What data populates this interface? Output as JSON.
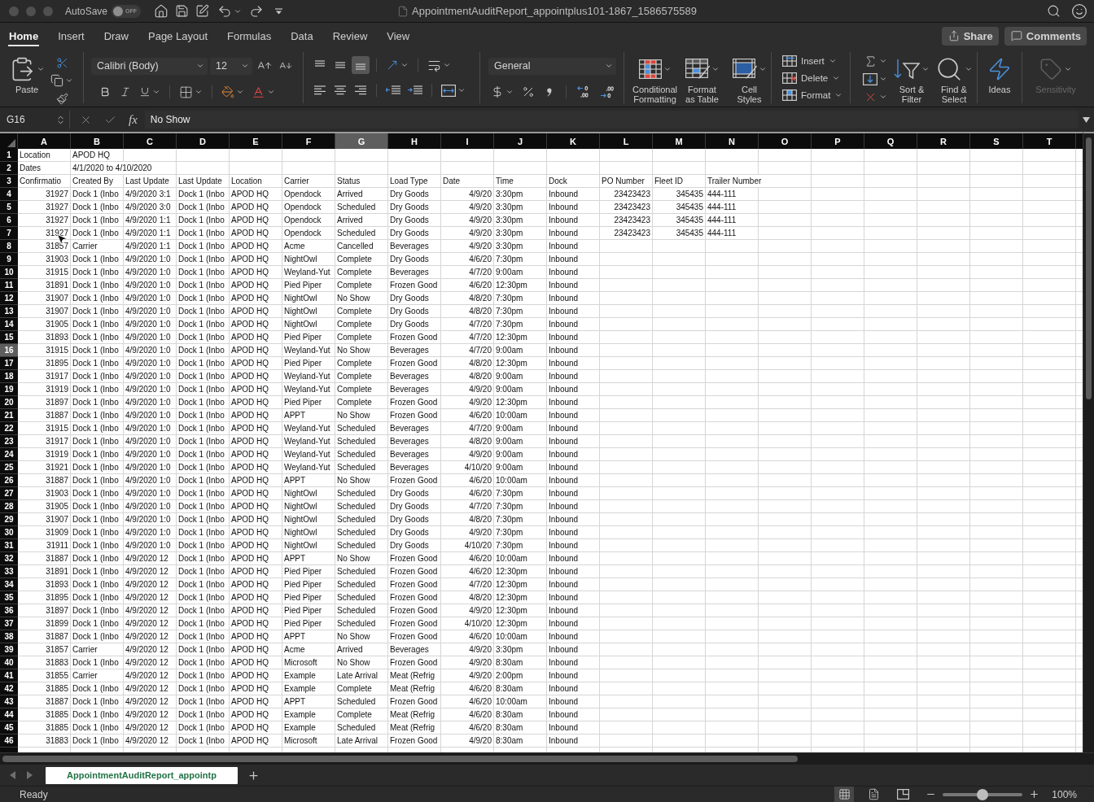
{
  "window": {
    "title": "AppointmentAuditReport_appointplus101-1867_1586575589",
    "autosave": {
      "label": "AutoSave",
      "on": false,
      "text": "OFF"
    }
  },
  "ribbon_tabs": [
    {
      "label": "Home",
      "selected": true
    },
    {
      "label": "Insert",
      "selected": false
    },
    {
      "label": "Draw",
      "selected": false
    },
    {
      "label": "Page Layout",
      "selected": false
    },
    {
      "label": "Formulas",
      "selected": false
    },
    {
      "label": "Data",
      "selected": false
    },
    {
      "label": "Review",
      "selected": false
    },
    {
      "label": "View",
      "selected": false
    }
  ],
  "header_actions": [
    {
      "kind": "share",
      "label": "Share"
    },
    {
      "kind": "comments",
      "label": "Comments"
    }
  ],
  "ribbon": {
    "paste_label": "Paste",
    "font_name": "Calibri (Body)",
    "font_size": "12",
    "vertical_alignment": [
      {
        "kind": "top",
        "selected": false
      },
      {
        "kind": "middle",
        "selected": false
      },
      {
        "kind": "bottom",
        "selected": true
      }
    ],
    "horizontal_alignment": [
      {
        "kind": "left",
        "selected": false
      },
      {
        "kind": "center",
        "selected": false
      },
      {
        "kind": "right",
        "selected": false
      }
    ],
    "number_format": "General",
    "styles": [
      {
        "kind": "conditional",
        "label": "Conditional\nFormatting"
      },
      {
        "kind": "table",
        "label": "Format\nas Table"
      },
      {
        "kind": "cell_styles",
        "label": "Cell\nStyles"
      }
    ],
    "cells": [
      {
        "kind": "insert",
        "label": "Insert"
      },
      {
        "kind": "delete",
        "label": "Delete"
      },
      {
        "kind": "format",
        "label": "Format"
      }
    ],
    "editing": [
      {
        "kind": "sort",
        "label": "Sort &\nFilter"
      },
      {
        "kind": "find",
        "label": "Find &\nSelect"
      }
    ],
    "insights": [
      {
        "kind": "ideas",
        "label": "Ideas",
        "disabled": false
      },
      {
        "kind": "sensitivity",
        "label": "Sensitivity",
        "disabled": true
      }
    ]
  },
  "formula_bar": {
    "name_box": "G16",
    "function_symbol": "fx",
    "formula": "No Show"
  },
  "sheet": {
    "column_letters": [
      {
        "label": "A",
        "selected": false
      },
      {
        "label": "B",
        "selected": false
      },
      {
        "label": "C",
        "selected": false
      },
      {
        "label": "D",
        "selected": false
      },
      {
        "label": "E",
        "selected": false
      },
      {
        "label": "F",
        "selected": false
      },
      {
        "label": "G",
        "selected": true
      },
      {
        "label": "H",
        "selected": false
      },
      {
        "label": "I",
        "selected": false
      },
      {
        "label": "J",
        "selected": false
      },
      {
        "label": "K",
        "selected": false
      },
      {
        "label": "L",
        "selected": false
      },
      {
        "label": "M",
        "selected": false
      },
      {
        "label": "N",
        "selected": false
      },
      {
        "label": "O",
        "selected": false
      },
      {
        "label": "P",
        "selected": false
      },
      {
        "label": "Q",
        "selected": false
      },
      {
        "label": "R",
        "selected": false
      },
      {
        "label": "S",
        "selected": false
      },
      {
        "label": "T",
        "selected": false
      }
    ],
    "fields": [
      {
        "heading": "Confirmatio",
        "numeric": true
      },
      {
        "heading": "Created By",
        "numeric": false
      },
      {
        "heading": "Last Update",
        "numeric": false
      },
      {
        "heading": "Last Update",
        "numeric": false
      },
      {
        "heading": "Location",
        "numeric": false
      },
      {
        "heading": "Carrier",
        "numeric": false
      },
      {
        "heading": "Status",
        "numeric": false
      },
      {
        "heading": "Load Type",
        "numeric": false
      },
      {
        "heading": "Date",
        "numeric": true
      },
      {
        "heading": "Time",
        "numeric": false
      },
      {
        "heading": "Dock",
        "numeric": false
      },
      {
        "heading": "PO Number",
        "numeric": true
      },
      {
        "heading": "Fleet ID",
        "numeric": true
      },
      {
        "heading": "Trailer Number",
        "numeric": false
      }
    ],
    "rows": [
      {
        "number": "1",
        "selected": false,
        "kind": "info",
        "cells": [
          "Location",
          "APOD HQ"
        ]
      },
      {
        "number": "2",
        "selected": false,
        "kind": "info",
        "cells": [
          "Dates",
          "4/1/2020 to 4/10/2020"
        ]
      },
      {
        "number": "3",
        "selected": false,
        "kind": "header"
      },
      {
        "number": "4",
        "selected": false,
        "kind": "record",
        "cells": [
          "31927",
          "Dock 1 (Inbo",
          "4/9/2020 3:1",
          "Dock 1 (Inbo",
          "APOD HQ",
          "Opendock",
          "Arrived",
          "Dry Goods",
          "4/9/20",
          "3:30pm",
          "Inbound",
          "23423423",
          "345435",
          "444-111"
        ]
      },
      {
        "number": "5",
        "selected": false,
        "kind": "record",
        "cells": [
          "31927",
          "Dock 1 (Inbo",
          "4/9/2020 3:0",
          "Dock 1 (Inbo",
          "APOD HQ",
          "Opendock",
          "Scheduled",
          "Dry Goods",
          "4/9/20",
          "3:30pm",
          "Inbound",
          "23423423",
          "345435",
          "444-111"
        ]
      },
      {
        "number": "6",
        "selected": false,
        "kind": "record",
        "cells": [
          "31927",
          "Dock 1 (Inbo",
          "4/9/2020 1:1",
          "Dock 1 (Inbo",
          "APOD HQ",
          "Opendock",
          "Arrived",
          "Dry Goods",
          "4/9/20",
          "3:30pm",
          "Inbound",
          "23423423",
          "345435",
          "444-111"
        ]
      },
      {
        "number": "7",
        "selected": false,
        "kind": "record",
        "cells": [
          "31927",
          "Dock 1 (Inbo",
          "4/9/2020 1:1",
          "Dock 1 (Inbo",
          "APOD HQ",
          "Opendock",
          "Scheduled",
          "Dry Goods",
          "4/9/20",
          "3:30pm",
          "Inbound",
          "23423423",
          "345435",
          "444-111"
        ]
      },
      {
        "number": "8",
        "selected": false,
        "kind": "record",
        "cells": [
          "31857",
          "Carrier",
          "4/9/2020 1:1",
          "Dock 1 (Inbo",
          "APOD HQ",
          "Acme",
          "Cancelled",
          "Beverages",
          "4/9/20",
          "3:30pm",
          "Inbound"
        ]
      },
      {
        "number": "9",
        "selected": false,
        "kind": "record",
        "cells": [
          "31903",
          "Dock 1 (Inbo",
          "4/9/2020 1:0",
          "Dock 1 (Inbo",
          "APOD HQ",
          "NightOwl",
          "Complete",
          "Dry Goods",
          "4/6/20",
          "7:30pm",
          "Inbound"
        ]
      },
      {
        "number": "10",
        "selected": false,
        "kind": "record",
        "cells": [
          "31915",
          "Dock 1 (Inbo",
          "4/9/2020 1:0",
          "Dock 1 (Inbo",
          "APOD HQ",
          "Weyland-Yut",
          "Complete",
          "Beverages",
          "4/7/20",
          "9:00am",
          "Inbound"
        ]
      },
      {
        "number": "11",
        "selected": false,
        "kind": "record",
        "cells": [
          "31891",
          "Dock 1 (Inbo",
          "4/9/2020 1:0",
          "Dock 1 (Inbo",
          "APOD HQ",
          "Pied Piper",
          "Complete",
          "Frozen Good",
          "4/6/20",
          "12:30pm",
          "Inbound"
        ]
      },
      {
        "number": "12",
        "selected": false,
        "kind": "record",
        "cells": [
          "31907",
          "Dock 1 (Inbo",
          "4/9/2020 1:0",
          "Dock 1 (Inbo",
          "APOD HQ",
          "NightOwl",
          "No Show",
          "Dry Goods",
          "4/8/20",
          "7:30pm",
          "Inbound"
        ]
      },
      {
        "number": "13",
        "selected": false,
        "kind": "record",
        "cells": [
          "31907",
          "Dock 1 (Inbo",
          "4/9/2020 1:0",
          "Dock 1 (Inbo",
          "APOD HQ",
          "NightOwl",
          "Complete",
          "Dry Goods",
          "4/8/20",
          "7:30pm",
          "Inbound"
        ]
      },
      {
        "number": "14",
        "selected": false,
        "kind": "record",
        "cells": [
          "31905",
          "Dock 1 (Inbo",
          "4/9/2020 1:0",
          "Dock 1 (Inbo",
          "APOD HQ",
          "NightOwl",
          "Complete",
          "Dry Goods",
          "4/7/20",
          "7:30pm",
          "Inbound"
        ]
      },
      {
        "number": "15",
        "selected": false,
        "kind": "record",
        "cells": [
          "31893",
          "Dock 1 (Inbo",
          "4/9/2020 1:0",
          "Dock 1 (Inbo",
          "APOD HQ",
          "Pied Piper",
          "Complete",
          "Frozen Good",
          "4/7/20",
          "12:30pm",
          "Inbound"
        ]
      },
      {
        "number": "16",
        "selected": true,
        "kind": "record",
        "cells": [
          "31915",
          "Dock 1 (Inbo",
          "4/9/2020 1:0",
          "Dock 1 (Inbo",
          "APOD HQ",
          "Weyland-Yut",
          "No Show",
          "Beverages",
          "4/7/20",
          "9:00am",
          "Inbound"
        ]
      },
      {
        "number": "17",
        "selected": false,
        "kind": "record",
        "cells": [
          "31895",
          "Dock 1 (Inbo",
          "4/9/2020 1:0",
          "Dock 1 (Inbo",
          "APOD HQ",
          "Pied Piper",
          "Complete",
          "Frozen Good",
          "4/8/20",
          "12:30pm",
          "Inbound"
        ]
      },
      {
        "number": "18",
        "selected": false,
        "kind": "record",
        "cells": [
          "31917",
          "Dock 1 (Inbo",
          "4/9/2020 1:0",
          "Dock 1 (Inbo",
          "APOD HQ",
          "Weyland-Yut",
          "Complete",
          "Beverages",
          "4/8/20",
          "9:00am",
          "Inbound"
        ]
      },
      {
        "number": "19",
        "selected": false,
        "kind": "record",
        "cells": [
          "31919",
          "Dock 1 (Inbo",
          "4/9/2020 1:0",
          "Dock 1 (Inbo",
          "APOD HQ",
          "Weyland-Yut",
          "Complete",
          "Beverages",
          "4/9/20",
          "9:00am",
          "Inbound"
        ]
      },
      {
        "number": "20",
        "selected": false,
        "kind": "record",
        "cells": [
          "31897",
          "Dock 1 (Inbo",
          "4/9/2020 1:0",
          "Dock 1 (Inbo",
          "APOD HQ",
          "Pied Piper",
          "Complete",
          "Frozen Good",
          "4/9/20",
          "12:30pm",
          "Inbound"
        ]
      },
      {
        "number": "21",
        "selected": false,
        "kind": "record",
        "cells": [
          "31887",
          "Dock 1 (Inbo",
          "4/9/2020 1:0",
          "Dock 1 (Inbo",
          "APOD HQ",
          "APPT",
          "No Show",
          "Frozen Good",
          "4/6/20",
          "10:00am",
          "Inbound"
        ]
      },
      {
        "number": "22",
        "selected": false,
        "kind": "record",
        "cells": [
          "31915",
          "Dock 1 (Inbo",
          "4/9/2020 1:0",
          "Dock 1 (Inbo",
          "APOD HQ",
          "Weyland-Yut",
          "Scheduled",
          "Beverages",
          "4/7/20",
          "9:00am",
          "Inbound"
        ]
      },
      {
        "number": "23",
        "selected": false,
        "kind": "record",
        "cells": [
          "31917",
          "Dock 1 (Inbo",
          "4/9/2020 1:0",
          "Dock 1 (Inbo",
          "APOD HQ",
          "Weyland-Yut",
          "Scheduled",
          "Beverages",
          "4/8/20",
          "9:00am",
          "Inbound"
        ]
      },
      {
        "number": "24",
        "selected": false,
        "kind": "record",
        "cells": [
          "31919",
          "Dock 1 (Inbo",
          "4/9/2020 1:0",
          "Dock 1 (Inbo",
          "APOD HQ",
          "Weyland-Yut",
          "Scheduled",
          "Beverages",
          "4/9/20",
          "9:00am",
          "Inbound"
        ]
      },
      {
        "number": "25",
        "selected": false,
        "kind": "record",
        "cells": [
          "31921",
          "Dock 1 (Inbo",
          "4/9/2020 1:0",
          "Dock 1 (Inbo",
          "APOD HQ",
          "Weyland-Yut",
          "Scheduled",
          "Beverages",
          "4/10/20",
          "9:00am",
          "Inbound"
        ]
      },
      {
        "number": "26",
        "selected": false,
        "kind": "record",
        "cells": [
          "31887",
          "Dock 1 (Inbo",
          "4/9/2020 1:0",
          "Dock 1 (Inbo",
          "APOD HQ",
          "APPT",
          "No Show",
          "Frozen Good",
          "4/6/20",
          "10:00am",
          "Inbound"
        ]
      },
      {
        "number": "27",
        "selected": false,
        "kind": "record",
        "cells": [
          "31903",
          "Dock 1 (Inbo",
          "4/9/2020 1:0",
          "Dock 1 (Inbo",
          "APOD HQ",
          "NightOwl",
          "Scheduled",
          "Dry Goods",
          "4/6/20",
          "7:30pm",
          "Inbound"
        ]
      },
      {
        "number": "28",
        "selected": false,
        "kind": "record",
        "cells": [
          "31905",
          "Dock 1 (Inbo",
          "4/9/2020 1:0",
          "Dock 1 (Inbo",
          "APOD HQ",
          "NightOwl",
          "Scheduled",
          "Dry Goods",
          "4/7/20",
          "7:30pm",
          "Inbound"
        ]
      },
      {
        "number": "29",
        "selected": false,
        "kind": "record",
        "cells": [
          "31907",
          "Dock 1 (Inbo",
          "4/9/2020 1:0",
          "Dock 1 (Inbo",
          "APOD HQ",
          "NightOwl",
          "Scheduled",
          "Dry Goods",
          "4/8/20",
          "7:30pm",
          "Inbound"
        ]
      },
      {
        "number": "30",
        "selected": false,
        "kind": "record",
        "cells": [
          "31909",
          "Dock 1 (Inbo",
          "4/9/2020 1:0",
          "Dock 1 (Inbo",
          "APOD HQ",
          "NightOwl",
          "Scheduled",
          "Dry Goods",
          "4/9/20",
          "7:30pm",
          "Inbound"
        ]
      },
      {
        "number": "31",
        "selected": false,
        "kind": "record",
        "cells": [
          "31911",
          "Dock 1 (Inbo",
          "4/9/2020 1:0",
          "Dock 1 (Inbo",
          "APOD HQ",
          "NightOwl",
          "Scheduled",
          "Dry Goods",
          "4/10/20",
          "7:30pm",
          "Inbound"
        ]
      },
      {
        "number": "32",
        "selected": false,
        "kind": "record",
        "cells": [
          "31887",
          "Dock 1 (Inbo",
          "4/9/2020 12",
          "Dock 1 (Inbo",
          "APOD HQ",
          "APPT",
          "No Show",
          "Frozen Good",
          "4/6/20",
          "10:00am",
          "Inbound"
        ]
      },
      {
        "number": "33",
        "selected": false,
        "kind": "record",
        "cells": [
          "31891",
          "Dock 1 (Inbo",
          "4/9/2020 12",
          "Dock 1 (Inbo",
          "APOD HQ",
          "Pied Piper",
          "Scheduled",
          "Frozen Good",
          "4/6/20",
          "12:30pm",
          "Inbound"
        ]
      },
      {
        "number": "34",
        "selected": false,
        "kind": "record",
        "cells": [
          "31893",
          "Dock 1 (Inbo",
          "4/9/2020 12",
          "Dock 1 (Inbo",
          "APOD HQ",
          "Pied Piper",
          "Scheduled",
          "Frozen Good",
          "4/7/20",
          "12:30pm",
          "Inbound"
        ]
      },
      {
        "number": "35",
        "selected": false,
        "kind": "record",
        "cells": [
          "31895",
          "Dock 1 (Inbo",
          "4/9/2020 12",
          "Dock 1 (Inbo",
          "APOD HQ",
          "Pied Piper",
          "Scheduled",
          "Frozen Good",
          "4/8/20",
          "12:30pm",
          "Inbound"
        ]
      },
      {
        "number": "36",
        "selected": false,
        "kind": "record",
        "cells": [
          "31897",
          "Dock 1 (Inbo",
          "4/9/2020 12",
          "Dock 1 (Inbo",
          "APOD HQ",
          "Pied Piper",
          "Scheduled",
          "Frozen Good",
          "4/9/20",
          "12:30pm",
          "Inbound"
        ]
      },
      {
        "number": "37",
        "selected": false,
        "kind": "record",
        "cells": [
          "31899",
          "Dock 1 (Inbo",
          "4/9/2020 12",
          "Dock 1 (Inbo",
          "APOD HQ",
          "Pied Piper",
          "Scheduled",
          "Frozen Good",
          "4/10/20",
          "12:30pm",
          "Inbound"
        ]
      },
      {
        "number": "38",
        "selected": false,
        "kind": "record",
        "cells": [
          "31887",
          "Dock 1 (Inbo",
          "4/9/2020 12",
          "Dock 1 (Inbo",
          "APOD HQ",
          "APPT",
          "No Show",
          "Frozen Good",
          "4/6/20",
          "10:00am",
          "Inbound"
        ]
      },
      {
        "number": "39",
        "selected": false,
        "kind": "record",
        "cells": [
          "31857",
          "Carrier",
          "4/9/2020 12",
          "Dock 1 (Inbo",
          "APOD HQ",
          "Acme",
          "Arrived",
          "Beverages",
          "4/9/20",
          "3:30pm",
          "Inbound"
        ]
      },
      {
        "number": "40",
        "selected": false,
        "kind": "record",
        "cells": [
          "31883",
          "Dock 1 (Inbo",
          "4/9/2020 12",
          "Dock 1 (Inbo",
          "APOD HQ",
          "Microsoft",
          "No Show",
          "Frozen Good",
          "4/9/20",
          "8:30am",
          "Inbound"
        ]
      },
      {
        "number": "41",
        "selected": false,
        "kind": "record",
        "cells": [
          "31855",
          "Carrier",
          "4/9/2020 12",
          "Dock 1 (Inbo",
          "APOD HQ",
          "Example",
          "Late Arrival",
          "Meat (Refrig",
          "4/9/20",
          "2:00pm",
          "Inbound"
        ]
      },
      {
        "number": "42",
        "selected": false,
        "kind": "record",
        "cells": [
          "31885",
          "Dock 1 (Inbo",
          "4/9/2020 12",
          "Dock 1 (Inbo",
          "APOD HQ",
          "Example",
          "Complete",
          "Meat (Refrig",
          "4/6/20",
          "8:30am",
          "Inbound"
        ]
      },
      {
        "number": "43",
        "selected": false,
        "kind": "record",
        "cells": [
          "31887",
          "Dock 1 (Inbo",
          "4/9/2020 12",
          "Dock 1 (Inbo",
          "APOD HQ",
          "APPT",
          "Scheduled",
          "Frozen Good",
          "4/6/20",
          "10:00am",
          "Inbound"
        ]
      },
      {
        "number": "44",
        "selected": false,
        "kind": "record",
        "cells": [
          "31885",
          "Dock 1 (Inbo",
          "4/9/2020 12",
          "Dock 1 (Inbo",
          "APOD HQ",
          "Example",
          "Complete",
          "Meat (Refrig",
          "4/6/20",
          "8:30am",
          "Inbound"
        ]
      },
      {
        "number": "45",
        "selected": false,
        "kind": "record",
        "cells": [
          "31885",
          "Dock 1 (Inbo",
          "4/9/2020 12",
          "Dock 1 (Inbo",
          "APOD HQ",
          "Example",
          "Scheduled",
          "Meat (Refrig",
          "4/6/20",
          "8:30am",
          "Inbound"
        ]
      },
      {
        "number": "46",
        "selected": false,
        "kind": "record",
        "cells": [
          "31883",
          "Dock 1 (Inbo",
          "4/9/2020 12",
          "Dock 1 (Inbo",
          "APOD HQ",
          "Microsoft",
          "Late Arrival",
          "Frozen Good",
          "4/9/20",
          "8:30am",
          "Inbound"
        ]
      }
    ]
  },
  "sheet_tabs": [
    {
      "label": "AppointmentAuditReport_appointp",
      "selected": true
    }
  ],
  "status_bar": {
    "status": "Ready",
    "views": [
      {
        "kind": "normal",
        "selected": true
      },
      {
        "kind": "page_layout",
        "selected": false
      },
      {
        "kind": "page_break",
        "selected": false
      }
    ],
    "zoom": {
      "level": 0.5,
      "text": "100%"
    }
  }
}
